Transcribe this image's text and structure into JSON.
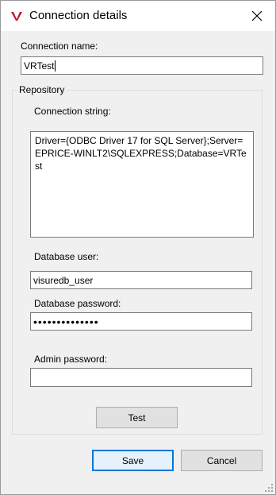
{
  "window": {
    "title": "Connection details",
    "close_icon": "close-icon",
    "logo_icon": "app-logo-icon",
    "accent_color": "#0078d7",
    "logo_color": "#c8102e"
  },
  "connection_name": {
    "label": "Connection name:",
    "value": "VRTest"
  },
  "repository": {
    "group_title": "Repository",
    "connection_string_label": "Connection string:",
    "connection_string_value": "Driver={ODBC Driver 17 for SQL Server};Server=EPRICE-WINLT2\\SQLEXPRESS;Database=VRTest",
    "db_user_label": "Database user:",
    "db_user_value": "visuredb_user",
    "db_password_label": "Database password:",
    "db_password_value": "••••••••••••••",
    "admin_password_label": "Admin password:",
    "admin_password_value": "",
    "test_button": "Test"
  },
  "footer": {
    "save_button": "Save",
    "cancel_button": "Cancel"
  }
}
